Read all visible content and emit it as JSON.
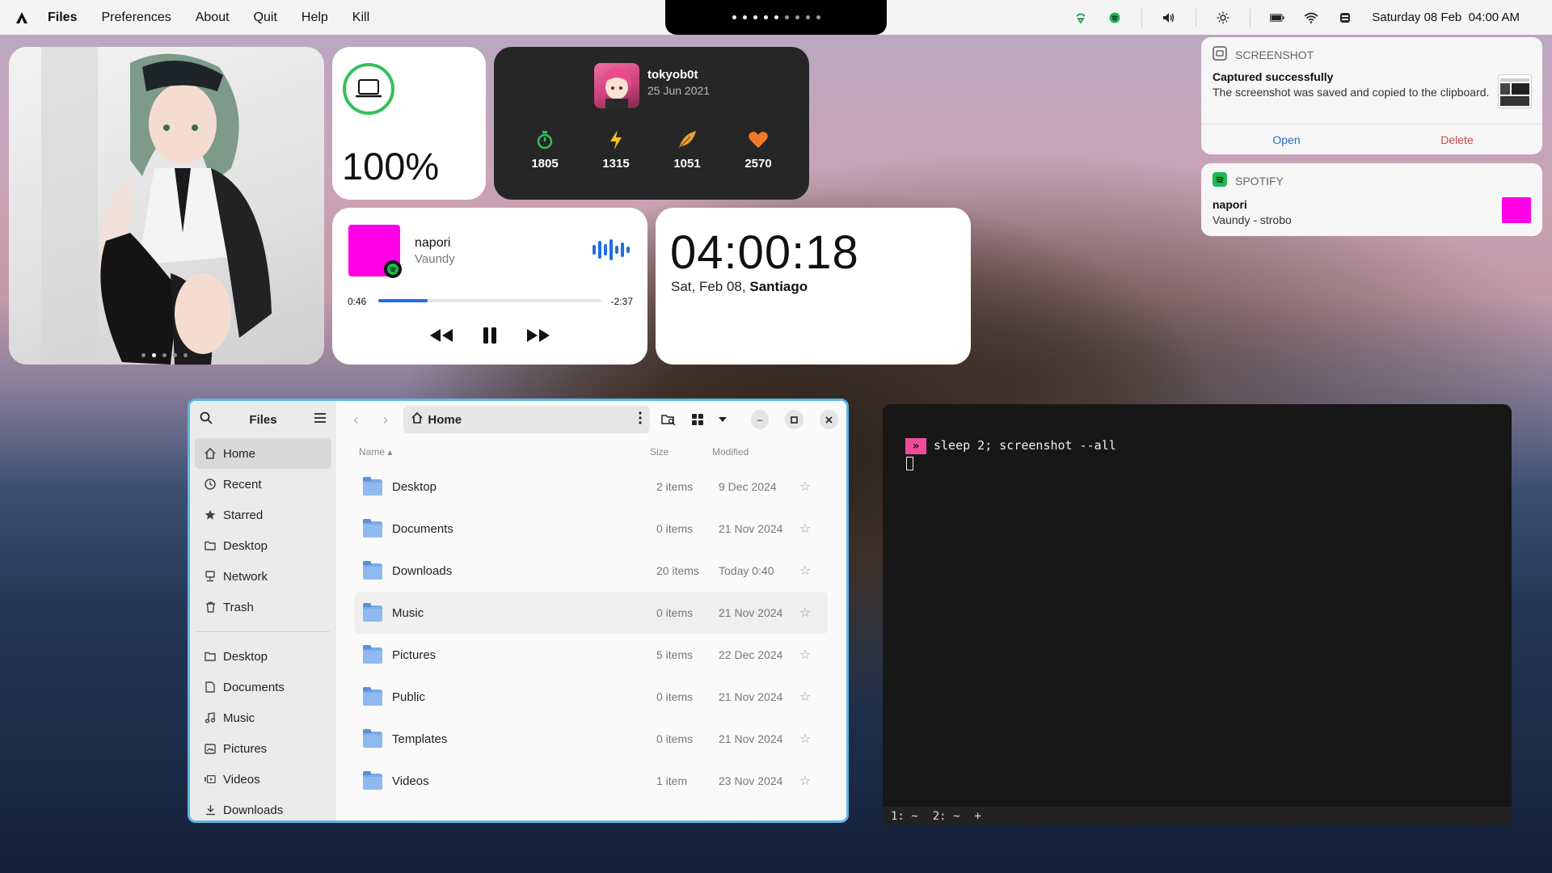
{
  "topbar": {
    "app": "Files",
    "menus": [
      "Preferences",
      "About",
      "Quit",
      "Help",
      "Kill"
    ],
    "datetime": "Saturday 08 Feb  04:00 AM",
    "workspaces": 9,
    "active_workspace": 4
  },
  "battery": {
    "value": "100%"
  },
  "profile": {
    "name": "tokyob0t",
    "date": "25 Jun 2021",
    "stats": [
      {
        "icon": "stopwatch-icon",
        "value": "1805",
        "color": "#35c05c"
      },
      {
        "icon": "bolt-icon",
        "value": "1315",
        "color": "#f5c518"
      },
      {
        "icon": "feather-icon",
        "value": "1051",
        "color": "#e8a43a"
      },
      {
        "icon": "heart-icon",
        "value": "2570",
        "color": "#f07a2a"
      }
    ]
  },
  "music": {
    "title": "napori",
    "artist": "Vaundy",
    "elapsed": "0:46",
    "remaining": "-2:37",
    "progress": 0.22,
    "cover_color": "#ff00e6"
  },
  "clock": {
    "time": "04:00:18",
    "date": "Sat, Feb 08,",
    "city": "Santiago"
  },
  "notifications": [
    {
      "app": "SCREENSHOT",
      "title": "Captured successfully",
      "body": "The screenshot was saved and copied to the clipboard.",
      "actions": [
        "Open",
        "Delete"
      ]
    },
    {
      "app": "SPOTIFY",
      "title": "napori",
      "body": "Vaundy - strobo"
    }
  ],
  "files": {
    "title": "Files",
    "path": "Home",
    "places": [
      {
        "icon": "home-icon",
        "label": "Home"
      },
      {
        "icon": "clock-icon",
        "label": "Recent"
      },
      {
        "icon": "star-icon",
        "label": "Starred"
      },
      {
        "icon": "folder-icon",
        "label": "Desktop"
      },
      {
        "icon": "network-icon",
        "label": "Network"
      },
      {
        "icon": "trash-icon",
        "label": "Trash"
      }
    ],
    "bookmarks": [
      {
        "icon": "folder-icon",
        "label": "Desktop"
      },
      {
        "icon": "document-icon",
        "label": "Documents"
      },
      {
        "icon": "music-icon",
        "label": "Music"
      },
      {
        "icon": "picture-icon",
        "label": "Pictures"
      },
      {
        "icon": "video-icon",
        "label": "Videos"
      },
      {
        "icon": "download-icon",
        "label": "Downloads"
      }
    ],
    "columns": {
      "name": "Name",
      "size": "Size",
      "modified": "Modified"
    },
    "rows": [
      {
        "name": "Desktop",
        "size": "2 items",
        "modified": "9 Dec 2024"
      },
      {
        "name": "Documents",
        "size": "0 items",
        "modified": "21 Nov 2024"
      },
      {
        "name": "Downloads",
        "size": "20 items",
        "modified": "Today 0:40"
      },
      {
        "name": "Music",
        "size": "0 items",
        "modified": "21 Nov 2024"
      },
      {
        "name": "Pictures",
        "size": "5 items",
        "modified": "22 Dec 2024"
      },
      {
        "name": "Public",
        "size": "0 items",
        "modified": "21 Nov 2024"
      },
      {
        "name": "Templates",
        "size": "0 items",
        "modified": "21 Nov 2024"
      },
      {
        "name": "Videos",
        "size": "1 item",
        "modified": "23 Nov 2024"
      }
    ]
  },
  "terminal": {
    "prompt_symbol": "»",
    "command": "sleep 2; screenshot --all",
    "tabs": [
      "1: ~",
      "2: ~",
      "+"
    ]
  },
  "colors": {
    "accent": "#1f6fe0",
    "battery": "#35c05c",
    "prompt": "#ee4c99",
    "window_border": "#5eb6e6"
  }
}
